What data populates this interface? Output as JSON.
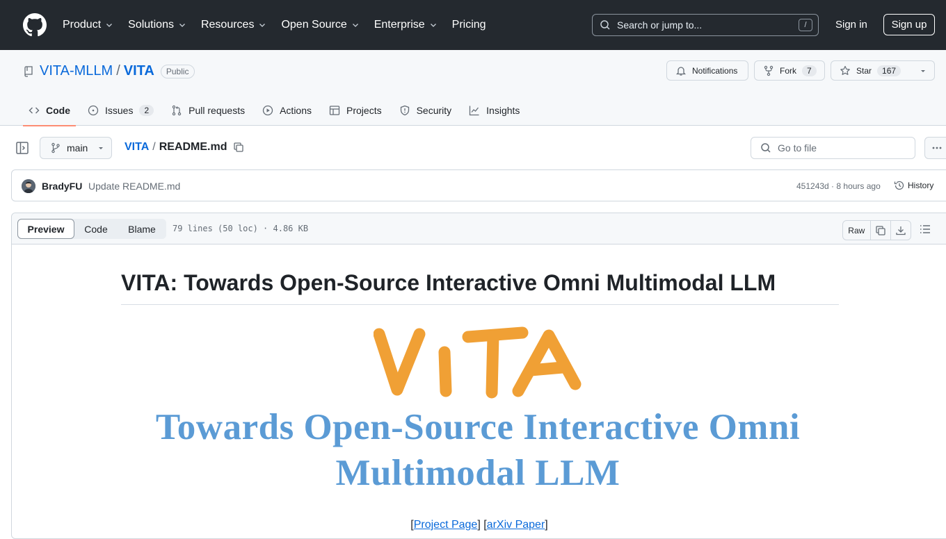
{
  "header": {
    "nav": [
      {
        "label": "Product",
        "has_menu": true
      },
      {
        "label": "Solutions",
        "has_menu": true
      },
      {
        "label": "Resources",
        "has_menu": true
      },
      {
        "label": "Open Source",
        "has_menu": true
      },
      {
        "label": "Enterprise",
        "has_menu": true
      },
      {
        "label": "Pricing",
        "has_menu": false
      }
    ],
    "search_placeholder": "Search or jump to...",
    "search_key": "/",
    "sign_in": "Sign in",
    "sign_up": "Sign up"
  },
  "repo": {
    "owner": "VITA-MLLM",
    "sep": "/",
    "name": "VITA",
    "visibility": "Public",
    "notifications_label": "Notifications",
    "fork_label": "Fork",
    "fork_count": "7",
    "star_label": "Star",
    "star_count": "167",
    "tabs": [
      {
        "label": "Code",
        "icon": "code-icon",
        "active": true
      },
      {
        "label": "Issues",
        "icon": "issue-icon",
        "count": "2"
      },
      {
        "label": "Pull requests",
        "icon": "pull-request-icon"
      },
      {
        "label": "Actions",
        "icon": "play-icon"
      },
      {
        "label": "Projects",
        "icon": "table-icon"
      },
      {
        "label": "Security",
        "icon": "shield-icon"
      },
      {
        "label": "Insights",
        "icon": "graph-icon"
      }
    ]
  },
  "filebar": {
    "branch": "main",
    "crumb_repo": "VITA",
    "crumb_sep": "/",
    "crumb_file": "README.md",
    "goto_placeholder": "Go to file"
  },
  "commit": {
    "author": "BradyFU",
    "message": "Update README.md",
    "meta": "451243d · 8 hours ago",
    "history": "History"
  },
  "file": {
    "views": [
      "Preview",
      "Code",
      "Blame"
    ],
    "info": "79 lines (50 loc) · 4.86 KB",
    "raw": "Raw"
  },
  "readme": {
    "title": "VITA: Towards Open-Source Interactive Omni Multimodal LLM",
    "logo_word": "VITA",
    "logo_line1": "Towards Open-Source Interactive Omni",
    "logo_line2": "Multimodal LLM",
    "links_open": "[",
    "link1": "Project Page",
    "links_mid": "] [",
    "link2": "arXiv Paper",
    "links_close": "]"
  },
  "colors": {
    "header_bg": "#24292f",
    "link": "#0969da",
    "active_tab_underline": "#fd8c73",
    "logo_orange": "#f0a035",
    "logo_blue": "#5b9bd5"
  }
}
